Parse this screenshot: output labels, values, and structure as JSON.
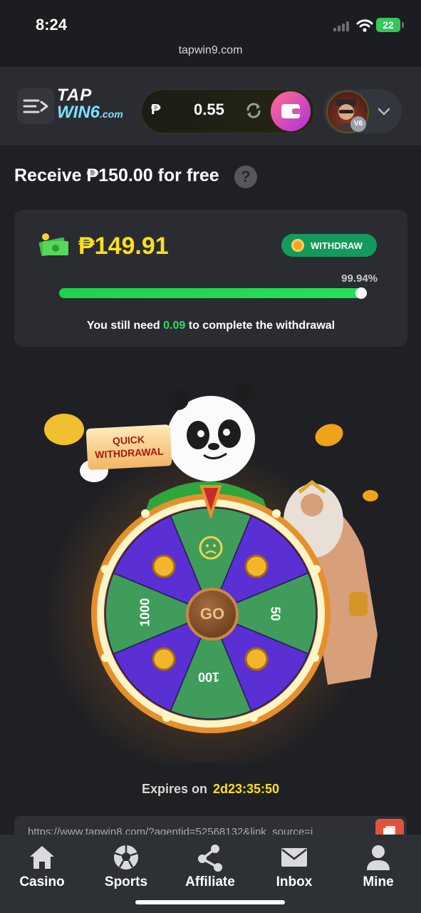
{
  "status_bar": {
    "time": "8:24",
    "battery": "22",
    "url": "tapwin9.com"
  },
  "header": {
    "logo_line1": "TAP",
    "logo_line2": "WIN6",
    "logo_suffix": ".com",
    "currency_symbol": "₱",
    "balance": "0.55",
    "vip_level": "V6",
    "icons": [
      "menu-icon",
      "refresh-icon",
      "wallet-icon",
      "chevron-down-icon"
    ]
  },
  "promo": {
    "title": "Receive ₱150.00 for free",
    "help": "?",
    "amount": "₱149.91",
    "withdraw_label": "WITHDRAW",
    "progress_text": "99.94%",
    "progress_fraction": 0.9994,
    "need_prefix": "You still need",
    "need_value": "0.09",
    "need_suffix": "to complete the withdrawal"
  },
  "wheel": {
    "badge_line1": "QUICK",
    "badge_line2": "WITHDRAWAL",
    "go_label": "GO",
    "segments": [
      "1000",
      "50",
      "100"
    ],
    "colors": {
      "purple": "#5a2fd4",
      "green": "#3f9c5a",
      "rim": "#e6902c"
    }
  },
  "expires": {
    "label": "Expires on",
    "value": "2d23:35:50"
  },
  "referral": {
    "link": "https://www.tapwin8.com/?agentid=52568132&link_source=i"
  },
  "nav": [
    {
      "label": "Casino",
      "icon": "home-icon"
    },
    {
      "label": "Sports",
      "icon": "soccer-ball-icon"
    },
    {
      "label": "Affiliate",
      "icon": "share-icon"
    },
    {
      "label": "Inbox",
      "icon": "mail-icon"
    },
    {
      "label": "Mine",
      "icon": "user-icon"
    }
  ]
}
